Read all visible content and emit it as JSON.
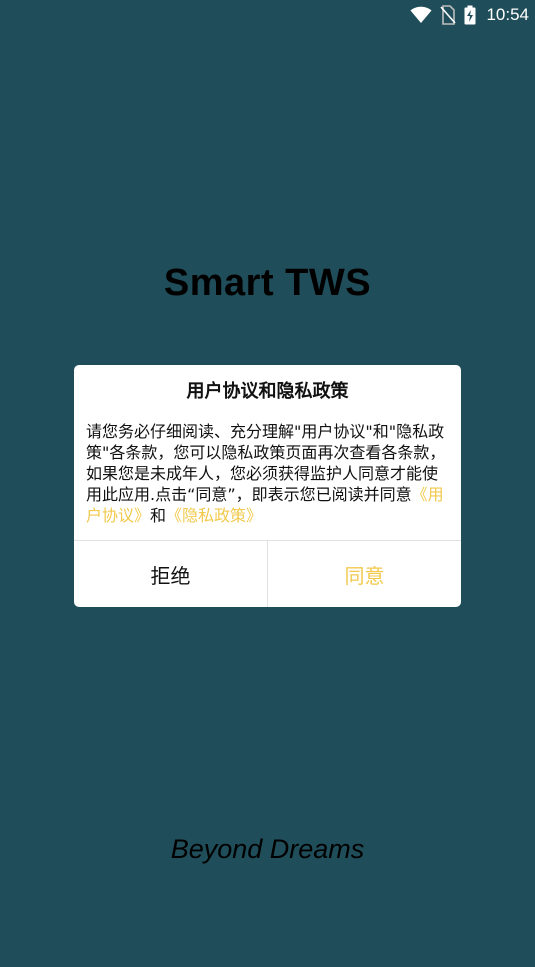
{
  "status_bar": {
    "time": "10:54",
    "icons": [
      "wifi-icon",
      "no-sim-icon",
      "battery-charging-icon"
    ]
  },
  "app": {
    "title": "Smart TWS",
    "slogan": "Beyond Dreams"
  },
  "dialog": {
    "title": "用户协议和隐私政策",
    "body_text": "请您务必仔细阅读、充分理解\"用户协议\"和\"隐私政策\"各条款，您可以隐私政策页面再次查看各条款，如果您是未成年人，您必须获得监护人同意才能使用此应用.点击“同意”，即表示您已阅读并同意",
    "user_agreement_link": "《用户协议》",
    "conjunction": "和",
    "privacy_policy_link": "《隐私政策》",
    "reject_label": "拒绝",
    "agree_label": "同意"
  },
  "colors": {
    "background": "#1f4e5a",
    "accent": "#f2c94c",
    "dialog_bg": "#ffffff"
  }
}
